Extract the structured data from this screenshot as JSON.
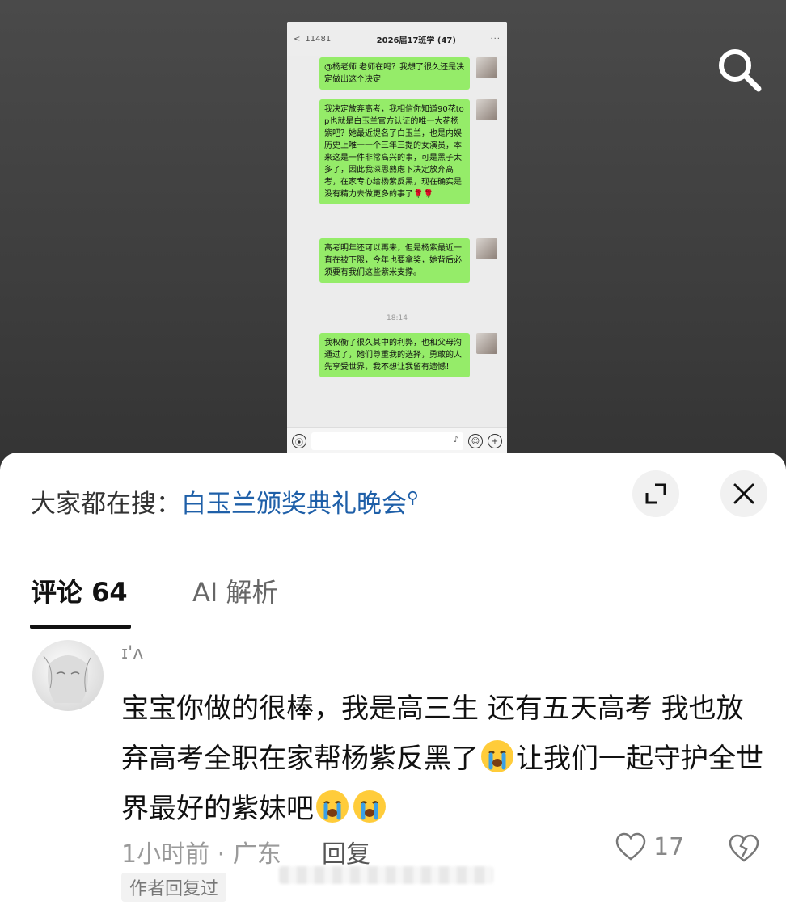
{
  "screenshot": {
    "header": {
      "back_label": "<",
      "unread_count": "11481",
      "group_title": "2026届17班学 (47)",
      "more_label": "···"
    },
    "messages": [
      "@杨老师 老师在吗？我想了很久还是决定做出这个决定",
      "我决定放弃高考，我相信你知道90花top也就是白玉兰官方认证的唯一大花杨紫吧？她最近提名了白玉兰，也是内娱历史上唯一一个三年三提的女演员，本来这是一件非常高兴的事，可是黑子太多了，因此我深思熟虑下决定放弃高考，在家专心给杨紫反黑，现在确实是没有精力去做更多的事了🌹🌹",
      "高考明年还可以再来，但是杨紫最近一直在被下限，今年也要拿奖，她背后必须要有我们这些紫米支撑。",
      "我权衡了很久其中的利弊，也和父母沟通过了，她们尊重我的选择，勇敢的人先享受世界，我不想让我留有遗憾！"
    ],
    "timestamp": "18:14"
  },
  "search_hint": {
    "prefix": "大家都在搜：",
    "keyword": "白玉兰颁奖典礼晚会"
  },
  "tabs": {
    "comments_label": "评论",
    "comments_count": "64",
    "ai_label": "AI 解析"
  },
  "comment": {
    "username": "ɪ'ʌ",
    "text_1": "宝宝你做的很棒，我是高三生 还有五天高考 我也放弃高考全职在家帮杨紫反黑了",
    "text_2": "让我们一起守护全世界最好的紫妹吧",
    "time_location": "1小时前 · 广东",
    "reply_label": "回复",
    "like_count": "17",
    "author_replied_label": "作者回复过"
  },
  "icons": {
    "search": "search-icon",
    "expand": "expand-icon",
    "close": "close-icon",
    "heart": "heart-icon",
    "dislike": "broken-heart-icon",
    "emoji": "crying-face-icon"
  },
  "colors": {
    "bubble_green": "#95ec69",
    "keyword_blue": "#1e5fa8"
  }
}
